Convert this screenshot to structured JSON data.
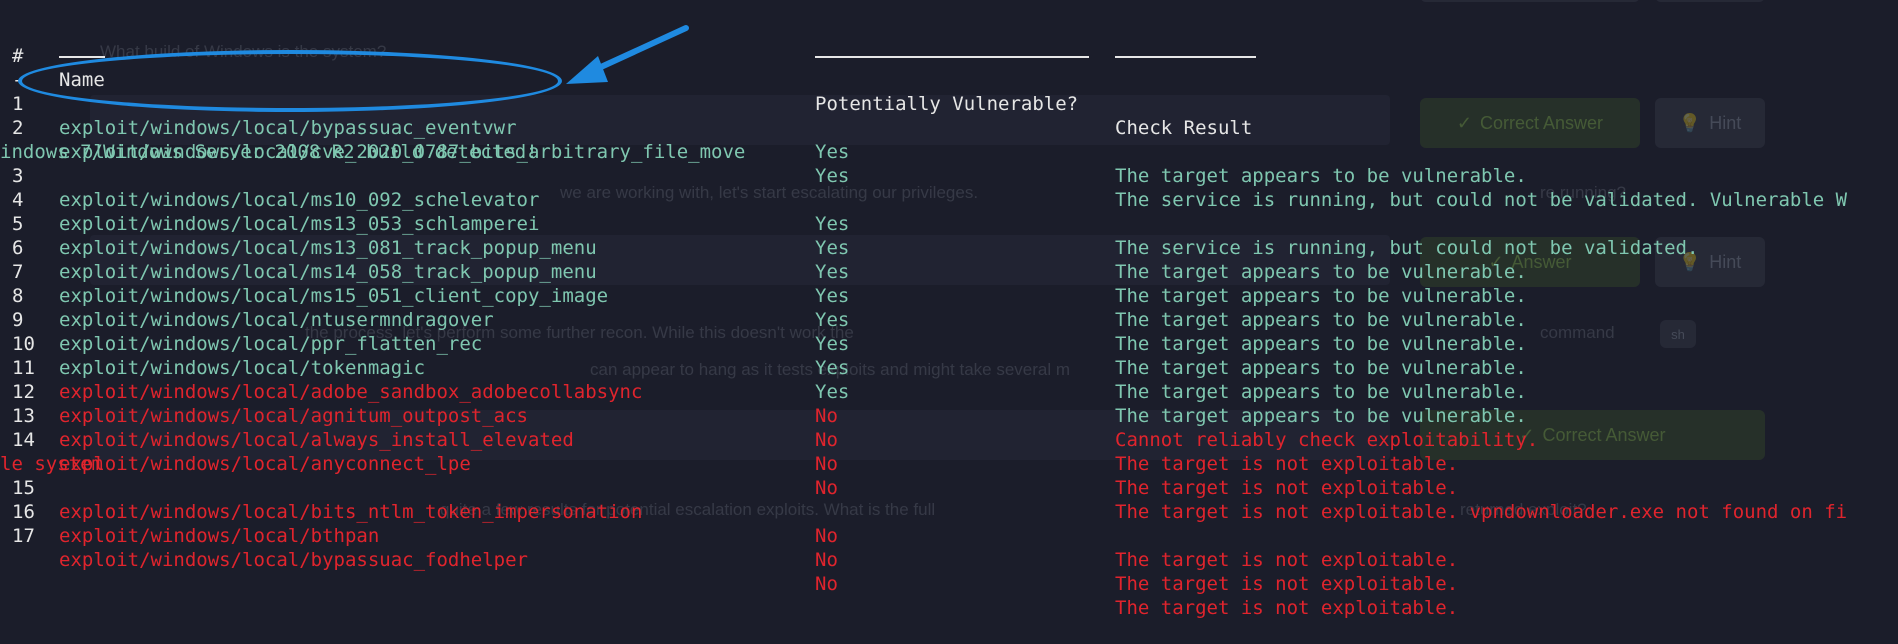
{
  "terminal": {
    "headers": {
      "num": "#",
      "name": "Name",
      "vuln": "Potentially Vulnerable?",
      "result": "Check Result",
      "num_ul": "-"
    },
    "rows": [
      {
        "num": "1",
        "name": "exploit/windows/local/bypassuac_eventvwr",
        "vuln": "Yes",
        "result": "The target appears to be vulnerable.",
        "color": "green"
      },
      {
        "num": "2",
        "name": "exploit/windows/local/cve_2020_0787_bits_arbitrary_file_move",
        "vuln": "Yes",
        "result": "The service is running, but could not be validated. Vulnerable W",
        "wrap": "indows 7/Windows Server 2008 R2 build detected!",
        "color": "green"
      },
      {
        "num": "3",
        "name": "exploit/windows/local/ms10_092_schelevator",
        "vuln": "Yes",
        "result": "The service is running, but could not be validated.",
        "color": "green"
      },
      {
        "num": "4",
        "name": "exploit/windows/local/ms13_053_schlamperei",
        "vuln": "Yes",
        "result": "The target appears to be vulnerable.",
        "color": "green"
      },
      {
        "num": "5",
        "name": "exploit/windows/local/ms13_081_track_popup_menu",
        "vuln": "Yes",
        "result": "The target appears to be vulnerable.",
        "color": "green"
      },
      {
        "num": "6",
        "name": "exploit/windows/local/ms14_058_track_popup_menu",
        "vuln": "Yes",
        "result": "The target appears to be vulnerable.",
        "color": "green"
      },
      {
        "num": "7",
        "name": "exploit/windows/local/ms15_051_client_copy_image",
        "vuln": "Yes",
        "result": "The target appears to be vulnerable.",
        "color": "green"
      },
      {
        "num": "8",
        "name": "exploit/windows/local/ntusermndragover",
        "vuln": "Yes",
        "result": "The target appears to be vulnerable.",
        "color": "green"
      },
      {
        "num": "9",
        "name": "exploit/windows/local/ppr_flatten_rec",
        "vuln": "Yes",
        "result": "The target appears to be vulnerable.",
        "color": "green"
      },
      {
        "num": "10",
        "name": "exploit/windows/local/tokenmagic",
        "vuln": "Yes",
        "result": "The target appears to be vulnerable.",
        "color": "green"
      },
      {
        "num": "11",
        "name": "exploit/windows/local/adobe_sandbox_adobecollabsync",
        "vuln": "No",
        "result": "Cannot reliably check exploitability.",
        "color": "red"
      },
      {
        "num": "12",
        "name": "exploit/windows/local/agnitum_outpost_acs",
        "vuln": "No",
        "result": "The target is not exploitable.",
        "color": "red"
      },
      {
        "num": "13",
        "name": "exploit/windows/local/always_install_elevated",
        "vuln": "No",
        "result": "The target is not exploitable.",
        "color": "red"
      },
      {
        "num": "14",
        "name": "exploit/windows/local/anyconnect_lpe",
        "vuln": "No",
        "result": "The target is not exploitable. vpndownloader.exe not found on fi",
        "wrap": "le system",
        "color": "red"
      },
      {
        "num": "15",
        "name": "exploit/windows/local/bits_ntlm_token_impersonation",
        "vuln": "No",
        "result": "The target is not exploitable.",
        "color": "red"
      },
      {
        "num": "16",
        "name": "exploit/windows/local/bthpan",
        "vuln": "No",
        "result": "The target is not exploitable.",
        "color": "red"
      },
      {
        "num": "17",
        "name": "exploit/windows/local/bypassuac_fodhelper",
        "vuln": "No",
        "result": "The target is not exploitable.",
        "color": "red"
      }
    ]
  },
  "background": {
    "text1": "What build of Windows is the system?",
    "text2": "we are working with, let's start escalating our privileges.",
    "text2b": "re running?",
    "text3": "the process, let's perform some further recon. While this doesn't work the",
    "text3b": "command",
    "text3c": "sh",
    "text4": "can appear to hang as it tests exploits and might take several m",
    "text5": "quite a few results for potential escalation exploits. What is the full",
    "text5b": "returned exploit?",
    "correct_answer": "Correct Answer",
    "answer": "Answer",
    "hint": "Hint"
  },
  "colors": {
    "background": "#1b1d2a",
    "header": "#e6e6e6",
    "vulnerable": "#7fc7b0",
    "not_vulnerable": "#e0242d",
    "annotation": "#1f8ae0"
  }
}
